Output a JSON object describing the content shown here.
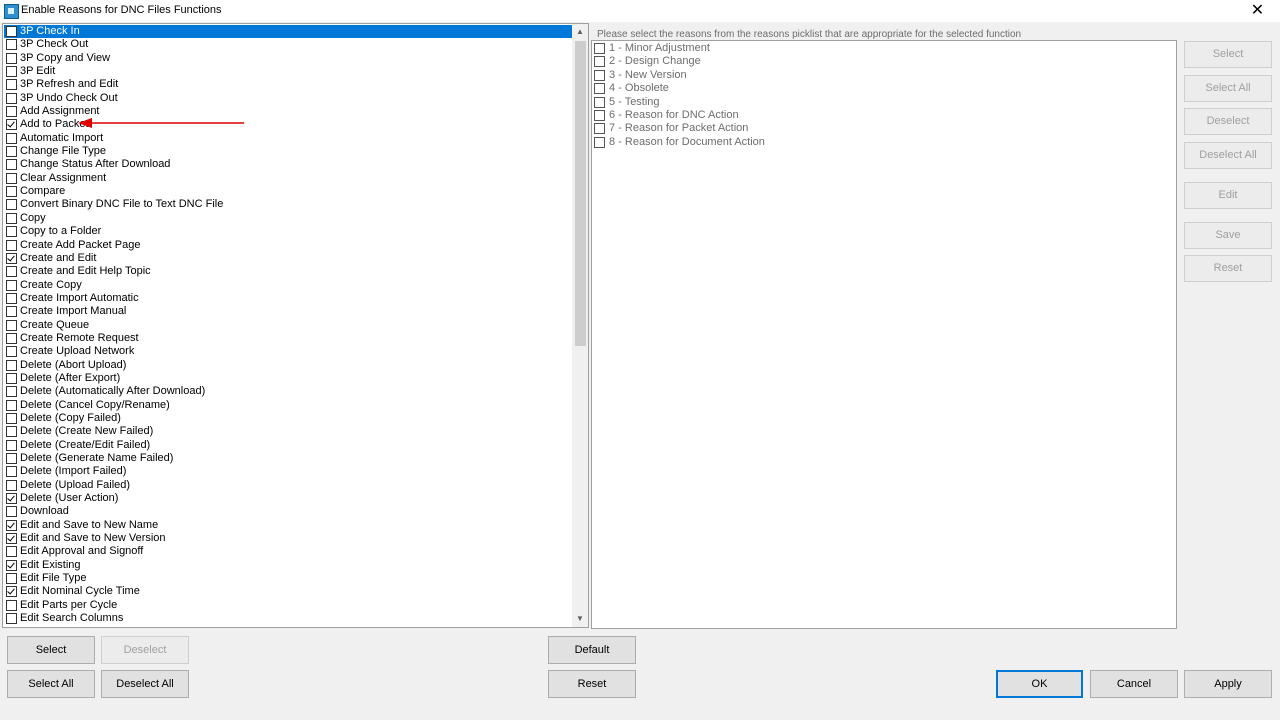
{
  "window": {
    "title": "Enable Reasons for DNC Files Functions",
    "close_glyph": "✕"
  },
  "functions": [
    {
      "label": "3P Check In",
      "checked": false,
      "selected": true
    },
    {
      "label": "3P Check Out",
      "checked": false
    },
    {
      "label": "3P Copy and View",
      "checked": false
    },
    {
      "label": "3P Edit",
      "checked": false
    },
    {
      "label": "3P Refresh and Edit",
      "checked": false
    },
    {
      "label": "3P Undo Check Out",
      "checked": false
    },
    {
      "label": "Add Assignment",
      "checked": false
    },
    {
      "label": "Add to Packet",
      "checked": true
    },
    {
      "label": "Automatic Import",
      "checked": false
    },
    {
      "label": "Change File Type",
      "checked": false
    },
    {
      "label": "Change Status After Download",
      "checked": false
    },
    {
      "label": "Clear Assignment",
      "checked": false
    },
    {
      "label": "Compare",
      "checked": false
    },
    {
      "label": "Convert Binary DNC File to Text DNC File",
      "checked": false
    },
    {
      "label": "Copy",
      "checked": false
    },
    {
      "label": "Copy to a Folder",
      "checked": false
    },
    {
      "label": "Create Add Packet Page",
      "checked": false
    },
    {
      "label": "Create and Edit",
      "checked": true
    },
    {
      "label": "Create and Edit Help Topic",
      "checked": false
    },
    {
      "label": "Create Copy",
      "checked": false
    },
    {
      "label": "Create Import Automatic",
      "checked": false
    },
    {
      "label": "Create Import Manual",
      "checked": false
    },
    {
      "label": "Create Queue",
      "checked": false
    },
    {
      "label": "Create Remote Request",
      "checked": false
    },
    {
      "label": "Create Upload Network",
      "checked": false
    },
    {
      "label": "Delete (Abort Upload)",
      "checked": false
    },
    {
      "label": "Delete (After Export)",
      "checked": false
    },
    {
      "label": "Delete (Automatically After Download)",
      "checked": false
    },
    {
      "label": "Delete (Cancel Copy/Rename)",
      "checked": false
    },
    {
      "label": "Delete (Copy Failed)",
      "checked": false
    },
    {
      "label": "Delete (Create New Failed)",
      "checked": false
    },
    {
      "label": "Delete (Create/Edit Failed)",
      "checked": false
    },
    {
      "label": "Delete (Generate Name Failed)",
      "checked": false
    },
    {
      "label": "Delete (Import Failed)",
      "checked": false
    },
    {
      "label": "Delete (Upload Failed)",
      "checked": false
    },
    {
      "label": "Delete (User Action)",
      "checked": true
    },
    {
      "label": "Download",
      "checked": false
    },
    {
      "label": "Edit and Save to New Name",
      "checked": true
    },
    {
      "label": "Edit and Save to New Version",
      "checked": true
    },
    {
      "label": "Edit Approval and Signoff",
      "checked": false
    },
    {
      "label": "Edit Existing",
      "checked": true
    },
    {
      "label": "Edit File Type",
      "checked": false
    },
    {
      "label": "Edit Nominal Cycle Time",
      "checked": true
    },
    {
      "label": "Edit Parts per Cycle",
      "checked": false
    },
    {
      "label": "Edit Search Columns",
      "checked": false
    }
  ],
  "reasons": {
    "hint": "Please select the reasons from the reasons picklist that are appropriate for the selected function",
    "items": [
      {
        "label": "1 - Minor Adjustment",
        "checked": false
      },
      {
        "label": "2 - Design Change",
        "checked": false
      },
      {
        "label": "3 - New Version",
        "checked": false
      },
      {
        "label": "4 - Obsolete",
        "checked": false
      },
      {
        "label": "5 - Testing",
        "checked": false
      },
      {
        "label": "6 - Reason for DNC Action",
        "checked": false
      },
      {
        "label": "7 - Reason for Packet Action",
        "checked": false
      },
      {
        "label": "8 - Reason for Document Action",
        "checked": false
      }
    ]
  },
  "side_buttons": {
    "select": "Select",
    "select_all": "Select All",
    "deselect": "Deselect",
    "deselect_all": "Deselect All",
    "edit": "Edit",
    "save": "Save",
    "reset": "Reset"
  },
  "bottom_buttons": {
    "select": "Select",
    "deselect": "Deselect",
    "select_all": "Select All",
    "deselect_all": "Deselect All",
    "default": "Default",
    "reset": "Reset",
    "ok": "OK",
    "cancel": "Cancel",
    "apply": "Apply"
  },
  "colors": {
    "selection": "#0078d7",
    "annotation_arrow": "#e00000"
  }
}
